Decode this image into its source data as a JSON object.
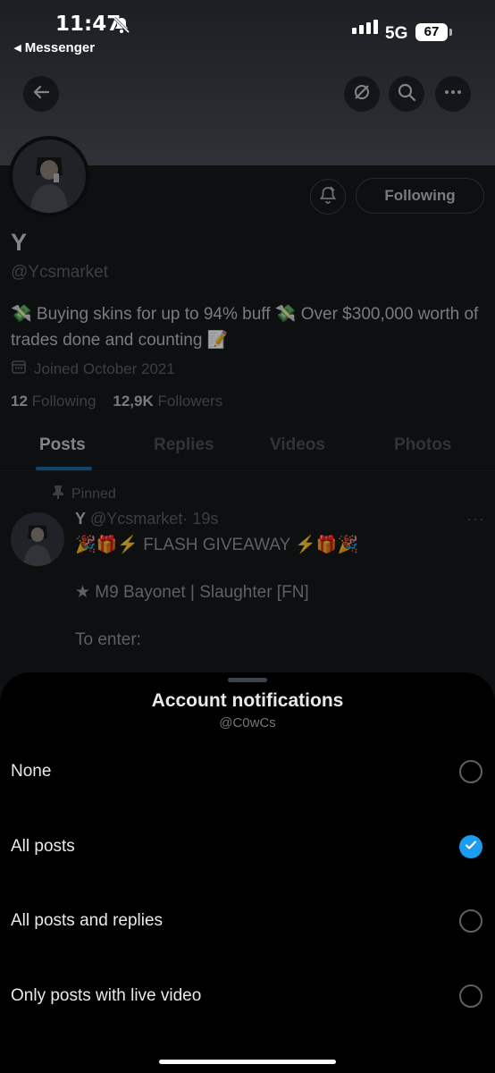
{
  "status": {
    "time": "11:47",
    "back_app": "◂ Messenger",
    "network": "5G",
    "battery": "67"
  },
  "profile": {
    "name": "Y",
    "handle": "@Ycsmarket",
    "bio": "💸 Buying skins for up to 94% buff 💸 Over $300,000 worth of trades done and counting 📝",
    "joined": "Joined October 2021",
    "following_count": "12",
    "following_label": "Following",
    "followers_count": "12,9K",
    "followers_label": "Followers",
    "follow_button": "Following"
  },
  "tabs": [
    "Posts",
    "Replies",
    "Videos",
    "Photos"
  ],
  "pinned_post": {
    "pinned_label": "Pinned",
    "author": "Y",
    "handle": "@Ycsmarket",
    "time": "· 19s",
    "lines": [
      "🎉🎁⚡ FLASH GIVEAWAY ⚡🎁🎉",
      "★ M9 Bayonet | Slaughter [FN]",
      "To enter:"
    ]
  },
  "sheet": {
    "title": "Account notifications",
    "subtitle": "@C0wCs",
    "options": [
      {
        "label": "None",
        "selected": false
      },
      {
        "label": "All posts",
        "selected": true
      },
      {
        "label": "All posts and replies",
        "selected": false
      },
      {
        "label": "Only posts with live video",
        "selected": false
      }
    ]
  },
  "colors": {
    "accent": "#1d9bf0",
    "sheet_bg": "#000000"
  },
  "icons": [
    "back-arrow-icon",
    "grok-icon",
    "search-icon",
    "more-icon",
    "bell-plus-icon",
    "calendar-icon",
    "pin-icon",
    "check-icon"
  ]
}
